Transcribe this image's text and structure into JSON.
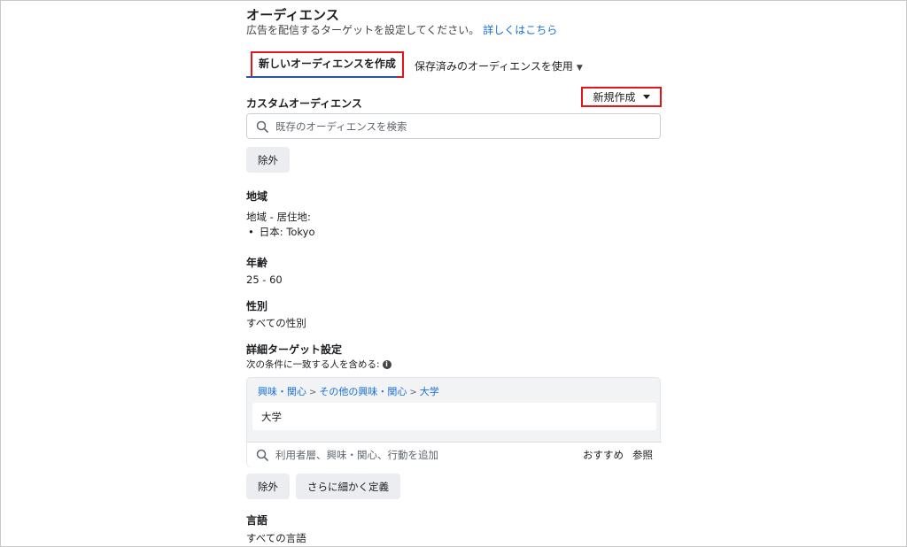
{
  "header": {
    "title": "オーディエンス",
    "subtitle": "広告を配信するターゲットを設定してください。",
    "details_link": "詳しくはこちら"
  },
  "tabs": {
    "active": "新しいオーディエンスを作成",
    "saved": "保存済みのオーディエンスを使用"
  },
  "custom_audience": {
    "label": "カスタムオーディエンス",
    "new_button": "新規作成",
    "search_placeholder": "既存のオーディエンスを検索",
    "exclude_button": "除外"
  },
  "region": {
    "label": "地域",
    "sub_label": "地域 - 居住地:",
    "items": [
      "日本: Tokyo"
    ]
  },
  "age": {
    "label": "年齢",
    "value": "25 - 60"
  },
  "gender": {
    "label": "性別",
    "value": "すべての性別"
  },
  "detailed_targeting": {
    "label": "詳細ターゲット設定",
    "description": "次の条件に一致する人を含める:",
    "breadcrumb": [
      "興味・関心",
      "その他の興味・関心",
      "大学"
    ],
    "selected": "大学",
    "search_placeholder": "利用者層、興味・関心、行動を追加",
    "suggest_link": "おすすめ",
    "browse_link": "参照",
    "exclude_button": "除外",
    "narrow_button": "さらに細かく定義"
  },
  "language": {
    "label": "言語",
    "value": "すべての言語"
  },
  "colors": {
    "highlight_border": "#e3151a",
    "link": "#1a6fd6",
    "tab_underline": "#2d54a8",
    "button_bg": "#ebedf0"
  }
}
